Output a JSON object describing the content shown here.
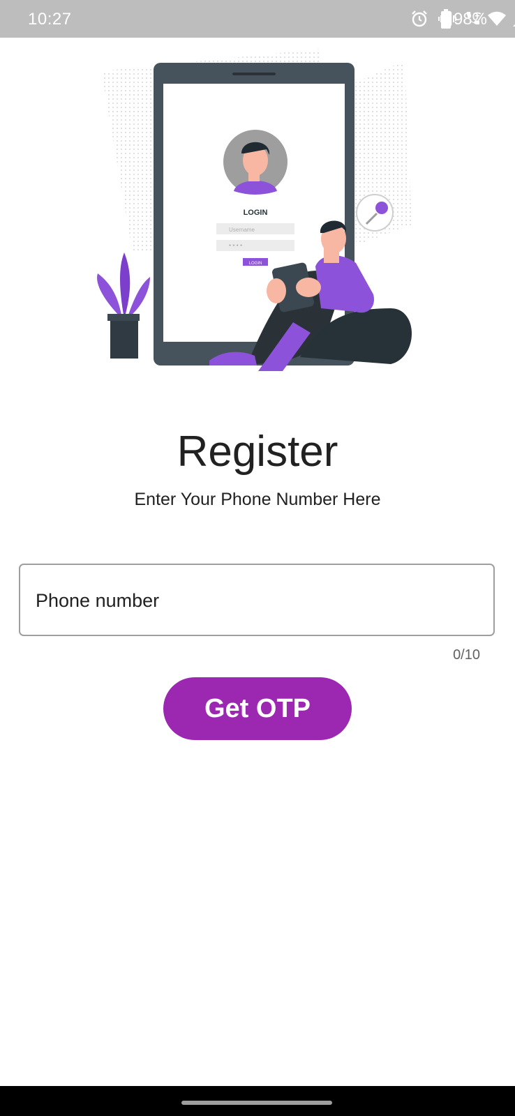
{
  "status_bar": {
    "time": "10:27",
    "battery_text": "98%",
    "icons": [
      "alarm-icon",
      "vibrate-icon",
      "wifi-call-icon",
      "wifi-icon",
      "cell-signal-icon",
      "battery-icon"
    ]
  },
  "illustration": {
    "login_heading": "LOGIN",
    "username_placeholder": "Username",
    "password_placeholder": "* * * *",
    "login_button": "LOGIN",
    "accent_color": "#8c52d9"
  },
  "register": {
    "title": "Register",
    "subtitle": "Enter Your Phone Number Here"
  },
  "phone_input": {
    "placeholder": "Phone number",
    "value": "",
    "counter": "0/10"
  },
  "otp_button": {
    "label": "Get OTP",
    "color": "#9c27b0"
  }
}
